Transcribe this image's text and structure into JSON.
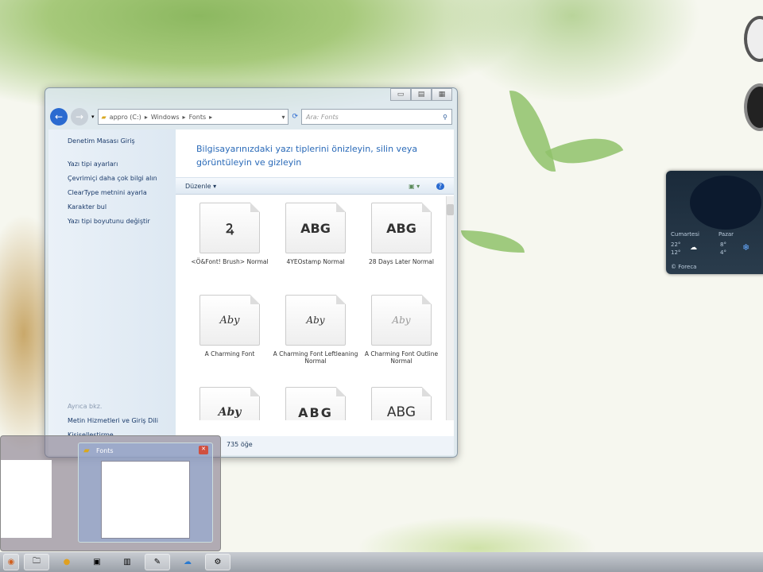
{
  "window": {
    "title": "Fonts",
    "address": [
      "appro (C:)",
      "Windows",
      "Fonts"
    ],
    "search_placeholder": "Ara: Fonts",
    "left_pane": {
      "home": "Denetim Masası Giriş",
      "links": [
        "Yazı tipi ayarları",
        "Çevrimiçi daha çok bilgi alın",
        "ClearType metnini ayarla",
        "Karakter bul",
        "Yazı tipi boyutunu değiştir"
      ],
      "see_also_title": "Ayrıca bkz.",
      "see_also": [
        "Metin Hizmetleri ve Giriş Dili",
        "Kişiselleştirme"
      ]
    },
    "header": "Bilgisayarınızdaki yazı tiplerini önizleyin, silin veya görüntüleyin ve gizleyin",
    "toolbar": {
      "organize": "Düzenle ▾"
    },
    "fonts": [
      {
        "sample": "Ꝝ",
        "name": "<Ö&Font! Brush> Normal"
      },
      {
        "sample": "ABG",
        "name": "4YEOstamp Normal"
      },
      {
        "sample": "ABG",
        "name": "28 Days Later Normal"
      },
      {
        "sample": "Aby",
        "name": "A Charming Font"
      },
      {
        "sample": "Aby",
        "name": "A Charming Font Leftleaning Normal"
      },
      {
        "sample": "Aby",
        "name": "A Charming Font Outline Normal"
      },
      {
        "sample": "Aby",
        "name": ""
      },
      {
        "sample": "ABG",
        "name": ""
      },
      {
        "sample": "ABG",
        "name": ""
      }
    ],
    "status": "735 öğe"
  },
  "thumbnail": {
    "title": "Fonts"
  },
  "weather": {
    "day1": "Cumartesi",
    "day1_hi": "22°",
    "day1_lo": "12°",
    "day2": "Pazar",
    "day2_hi": "8°",
    "day2_lo": "4°",
    "credit": "© Foreca"
  }
}
